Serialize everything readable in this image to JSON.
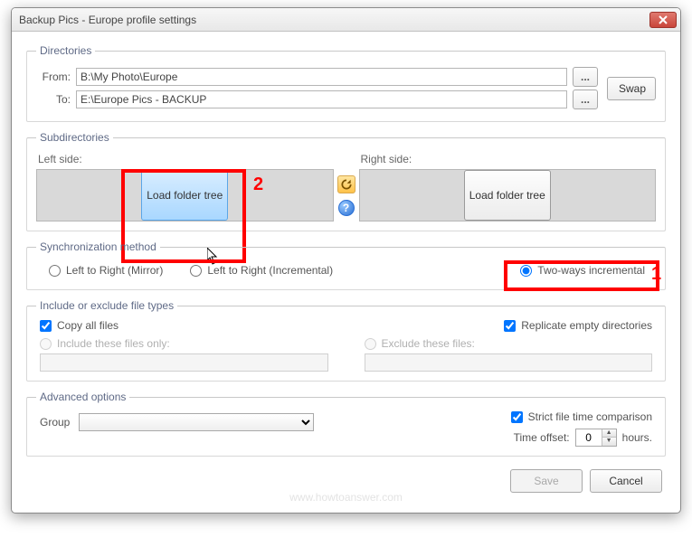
{
  "window": {
    "title": "Backup Pics - Europe profile settings"
  },
  "directories": {
    "legend": "Directories",
    "from_label": "From:",
    "to_label": "To:",
    "from_path": "B:\\My Photo\\Europe",
    "to_path": "E:\\Europe Pics - BACKUP",
    "browse_label": "...",
    "swap_label": "Swap"
  },
  "subdirs": {
    "legend": "Subdirectories",
    "left_label": "Left side:",
    "right_label": "Right side:",
    "load_left": "Load folder tree",
    "load_right": "Load folder tree"
  },
  "sync": {
    "legend": "Synchronization method",
    "opt1": "Left to Right (Mirror)",
    "opt2": "Left to Right (Incremental)",
    "opt3": "Two-ways incremental"
  },
  "include": {
    "legend": "Include or exclude file types",
    "copy_all": "Copy all files",
    "replicate": "Replicate empty directories",
    "include_only": "Include these files only:",
    "exclude": "Exclude these files:"
  },
  "advanced": {
    "legend": "Advanced options",
    "group_label": "Group",
    "strict": "Strict file time comparison",
    "time_offset_label": "Time offset:",
    "time_offset_value": "0",
    "hours_label": "hours."
  },
  "buttons": {
    "save": "Save",
    "cancel": "Cancel"
  },
  "callouts": {
    "one": "1",
    "two": "2"
  },
  "watermark": "www.howtoanswer.com"
}
